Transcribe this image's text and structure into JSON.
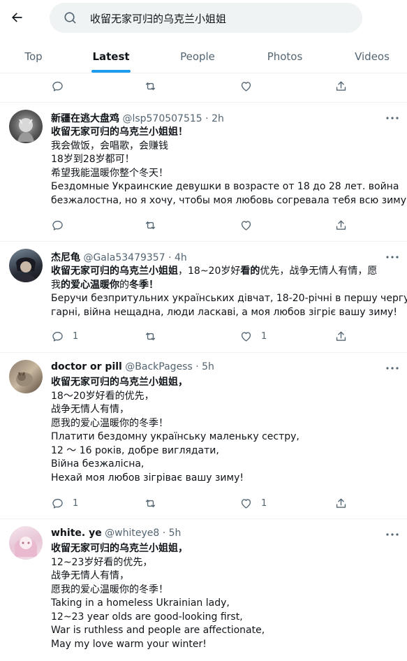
{
  "search": {
    "query": "收留无家可归的乌克兰小姐姐"
  },
  "tabs": [
    {
      "label": "Top"
    },
    {
      "label": "Latest"
    },
    {
      "label": "People"
    },
    {
      "label": "Photos"
    },
    {
      "label": "Videos"
    }
  ],
  "tweets": [
    {
      "name": "新疆在逃大盘鸡",
      "handle": "@lsp570507515",
      "dot": "·",
      "time": "2h",
      "lines": [
        "收留无家可归的乌克兰小姐姐！",
        "我会做饭，会唱歌，会赚钱",
        "18岁到28岁都可！",
        "希望我能温暖你整个冬天！",
        "Бездомные Украинские девушки в возрасте от 18 до 28 лет. война",
        "безжалостна, но я хочу, чтобы моя любовь согревала тебя всю зиму."
      ],
      "replies": "",
      "likes": ""
    },
    {
      "name": "杰尼龟",
      "handle": "@Gala53479357",
      "dot": "·",
      "time": "4h",
      "line1_bold": "收留无家可归的乌克兰小姐姐",
      "line1_rest": "，18~20岁好",
      "line1_bold2": "看的",
      "line1_rest2": "优先，战争无情人有情，愿",
      "line2_a": "我",
      "line2_b": "的爱心温暖你",
      "line2_c": "的",
      "line2_d": "冬季！",
      "lines": [
        "Беручи безпритульних українських дівчат, 18-20-річні в першу чергу",
        "гарні, війна нещадна, люди ласкаві, а моя любов зігріє вашу зиму!"
      ],
      "replies": "1",
      "likes": "1"
    },
    {
      "name": "doctor or pill",
      "handle": "@BackPagess",
      "dot": "·",
      "time": "5h",
      "lines": [
        "收留无家可归的乌克兰小姐姐，",
        "18～20岁好看的优先，",
        "战争无情人有情，",
        "愿我的爱心温暖你的冬季！",
        "Платити бездомну українську маленьку сестру,",
        "12 ～ 16 років, добре виглядати,",
        "Війна безжалісна,",
        "Нехай моя любов зігріває вашу зиму!"
      ],
      "replies": "1",
      "likes": "1"
    },
    {
      "name": "white. ye",
      "handle": "@whiteye8",
      "dot": "·",
      "time": "5h",
      "lines": [
        "收留无家可归的乌克兰小姐姐，",
        "12~23岁好看的优先，",
        "战争无情人有情，",
        "愿我的爱心温暖你的冬季！",
        "Taking in a homeless Ukrainian lady,",
        "12~23 year olds are good-looking first,",
        "War is ruthless and people are affectionate,",
        "May my love warm your winter!"
      ]
    }
  ],
  "colors": {
    "accent": "#1d9bf0",
    "text": "#0f1419",
    "secondary": "#536471"
  }
}
